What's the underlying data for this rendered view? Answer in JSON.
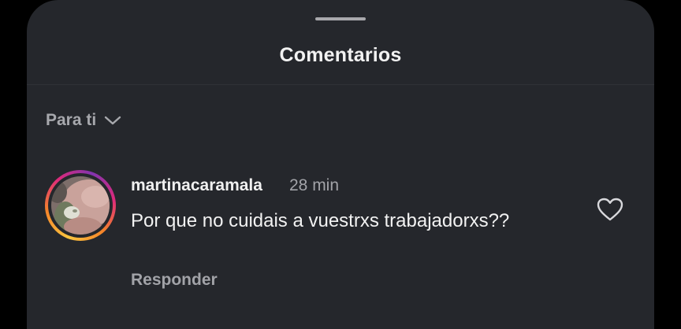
{
  "sheet": {
    "title": "Comentarios"
  },
  "filter": {
    "label": "Para ti",
    "icon": "chevron-down-icon"
  },
  "comments": [
    {
      "username": "martinacaramala",
      "time": "28 min",
      "text": "Por que no cuidais a vuestrxs trabajadorxs??",
      "reply_label": "Responder",
      "like_icon": "heart-icon",
      "avatar_icon": "profile-photo"
    }
  ],
  "colors": {
    "background": "#25272c",
    "primary_text": "#f2f2f2",
    "secondary_text": "#a2a3a8",
    "story_ring": [
      "#f9c440",
      "#f58529",
      "#dd2a7b",
      "#8134af"
    ]
  }
}
